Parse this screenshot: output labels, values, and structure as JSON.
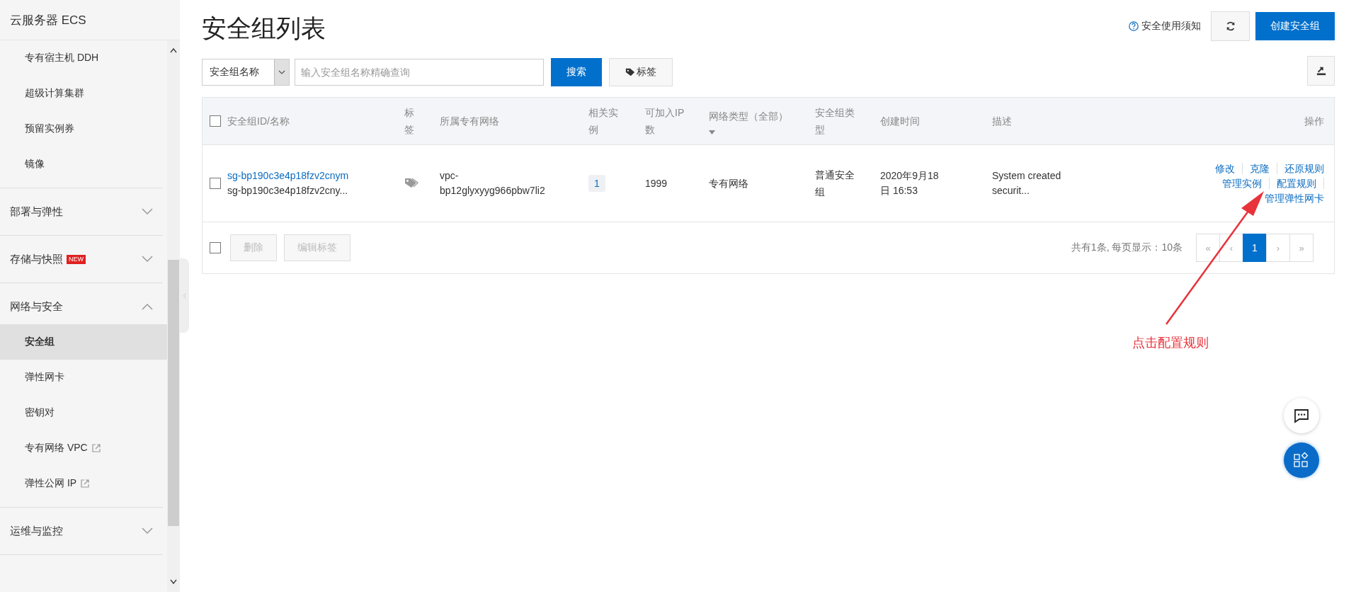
{
  "sidebar": {
    "title": "云服务器 ECS",
    "items": [
      {
        "kind": "item",
        "label": "专有宿主机 DDH",
        "selected": false,
        "external": false
      },
      {
        "kind": "item",
        "label": "超级计算集群",
        "selected": false,
        "external": false
      },
      {
        "kind": "item",
        "label": "预留实例券",
        "selected": false,
        "external": false
      },
      {
        "kind": "item",
        "label": "镜像",
        "selected": false,
        "external": false
      },
      {
        "kind": "group",
        "label": "部署与弹性",
        "expanded": false
      },
      {
        "kind": "group",
        "label": "存储与快照",
        "badge": "NEW",
        "expanded": false
      },
      {
        "kind": "group",
        "label": "网络与安全",
        "expanded": true,
        "children": [
          {
            "kind": "item",
            "label": "安全组",
            "selected": true,
            "external": false
          },
          {
            "kind": "item",
            "label": "弹性网卡",
            "selected": false,
            "external": false
          },
          {
            "kind": "item",
            "label": "密钥对",
            "selected": false,
            "external": false
          },
          {
            "kind": "item",
            "label": "专有网络 VPC",
            "selected": false,
            "external": true
          },
          {
            "kind": "item",
            "label": "弹性公网 IP",
            "selected": false,
            "external": true
          }
        ]
      },
      {
        "kind": "group",
        "label": "运维与监控",
        "expanded": false
      }
    ]
  },
  "page": {
    "title": "安全组列表",
    "help_link": "安全使用须知",
    "create_button": "创建安全组"
  },
  "search": {
    "field_select": "安全组名称",
    "placeholder": "输入安全组名称精确查询",
    "search_button": "搜索",
    "tag_button": "标签"
  },
  "table": {
    "select_all": {
      "checked": false
    },
    "columns": [
      {
        "label": "安全组ID/名称",
        "kind": "id"
      },
      {
        "label": "标签",
        "kind": "tag"
      },
      {
        "label": "所属专有网络",
        "kind": "vpc"
      },
      {
        "label": "相关实例",
        "kind": "inst"
      },
      {
        "label": "可加入IP数",
        "kind": "ip"
      },
      {
        "label": "网络类型（全部）",
        "kind": "net",
        "filter": true
      },
      {
        "label": "安全组类型",
        "kind": "type"
      },
      {
        "label": "创建时间",
        "kind": "created"
      },
      {
        "label": "描述",
        "kind": "desc"
      },
      {
        "label": "操作",
        "kind": "ops"
      }
    ],
    "rows": [
      {
        "selected": false,
        "id": "sg-bp190c3e4p18fzv2cnym",
        "name": "sg-bp190c3e4p18fzv2cny...",
        "vpc": "vpc-bp12glyxyyg966pbw7li2",
        "instances": "1",
        "ip_count": "1999",
        "network_type": "专有网络",
        "group_type": "普通安全组",
        "created": "2020年9月18日 16:53",
        "description": "System created securit...",
        "actions": [
          "修改",
          "克隆",
          "还原规则",
          "管理实例",
          "配置规则",
          "管理弹性网卡"
        ]
      }
    ],
    "footer": {
      "select_all": {
        "checked": false
      },
      "buttons": [
        {
          "label": "删除",
          "disabled": true
        },
        {
          "label": "编辑标签",
          "disabled": true
        }
      ],
      "summary": "共有1条, 每页显示：10条",
      "pages": [
        {
          "kind": "first",
          "label": "«",
          "selected": false,
          "disabled": true
        },
        {
          "kind": "prev",
          "label": "‹",
          "selected": false,
          "disabled": true
        },
        {
          "kind": "page",
          "label": "1",
          "selected": true,
          "disabled": false
        },
        {
          "kind": "next",
          "label": "›",
          "selected": false,
          "disabled": true
        },
        {
          "kind": "last",
          "label": "»",
          "selected": false,
          "disabled": true
        }
      ]
    }
  },
  "annotation": {
    "text": "点击配置规则"
  }
}
